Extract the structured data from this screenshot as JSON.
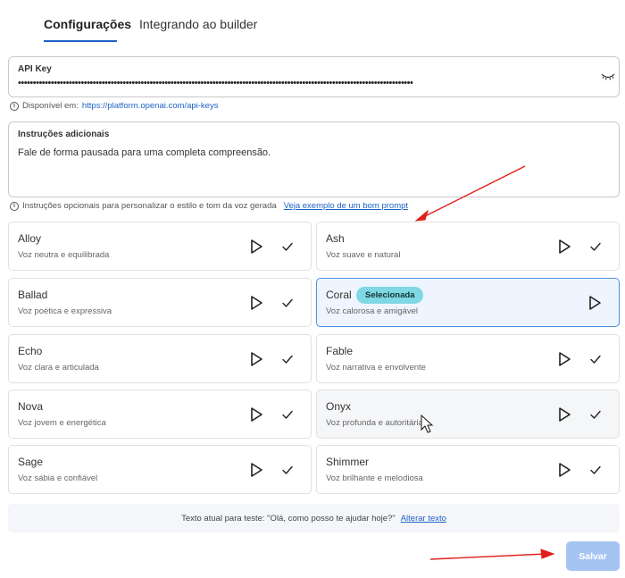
{
  "tabs": [
    {
      "label": "Configurações",
      "active": true
    },
    {
      "label": "Integrando ao builder",
      "active": false
    }
  ],
  "api_key": {
    "label": "API Key",
    "masked_value": "••••••••••••••••••••••••••••••••••••••••••••••••••••••••••••••••••••••••••••••••••••••••••••••••••••••••••••••••••••••••••••••••••••",
    "help_prefix": "Disponível em:",
    "help_link": "https://platform.openai.com/api-keys"
  },
  "instructions": {
    "label": "Instruções adicionais",
    "value": "Fale de forma pausada para uma completa compreensão.",
    "help_text": "Instruções opcionais para personalizar o estilo e tom da voz gerada",
    "help_link": "Veja exemplo de um bom prompt"
  },
  "voices": [
    {
      "name": "Alloy",
      "description": "Voz neutra e equilibrada",
      "selected": false
    },
    {
      "name": "Ash",
      "description": "Voz suave e natural",
      "selected": false
    },
    {
      "name": "Ballad",
      "description": "Voz poética e expressiva",
      "selected": false
    },
    {
      "name": "Coral",
      "description": "Voz calorosa e amigável",
      "selected": true,
      "badge": "Selecionada"
    },
    {
      "name": "Echo",
      "description": "Voz clara e articulada",
      "selected": false
    },
    {
      "name": "Fable",
      "description": "Voz narrativa e envolvente",
      "selected": false
    },
    {
      "name": "Nova",
      "description": "Voz jovem e energética",
      "selected": false
    },
    {
      "name": "Onyx",
      "description": "Voz profunda e autoritária",
      "selected": false
    },
    {
      "name": "Sage",
      "description": "Voz sábia e confiável",
      "selected": false
    },
    {
      "name": "Shimmer",
      "description": "Voz brilhante e melodiosa",
      "selected": false
    }
  ],
  "test": {
    "text": "Texto atual para teste: \"Olá, como posso te ajudar hoje?\"",
    "link": "Alterar texto"
  },
  "save_label": "Salvar",
  "colors": {
    "accent": "#1e63c7",
    "badge": "#7fd8e3",
    "selected_border": "#4a8fe0",
    "save_disabled": "#a5c4f2",
    "annotation_arrow": "#e0201a"
  },
  "icons": {
    "eye": "eye-closed-icon",
    "info": "info-icon",
    "play": "play-icon",
    "check": "check-icon",
    "cursor": "mouse-cursor-icon"
  }
}
